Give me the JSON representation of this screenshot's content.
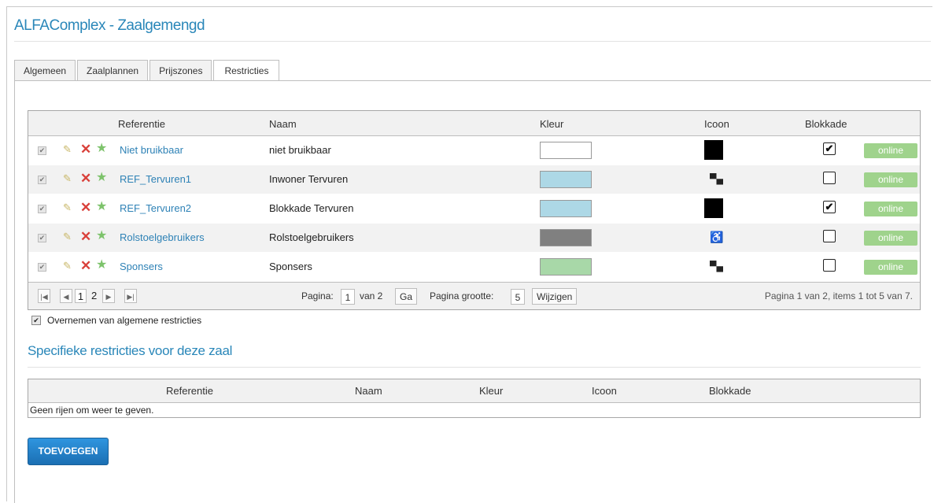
{
  "header": {
    "title": "ALFAComplex - Zaalgemengd"
  },
  "tabs": [
    {
      "label": "Algemeen",
      "active": false
    },
    {
      "label": "Zaalplannen",
      "active": false
    },
    {
      "label": "Prijszones",
      "active": false
    },
    {
      "label": "Restricties",
      "active": true
    }
  ],
  "restrictions_grid": {
    "columns": [
      "Referentie",
      "Naam",
      "Kleur",
      "Icoon",
      "Blokkade"
    ],
    "rows": [
      {
        "referentie": "Niet bruikbaar",
        "naam": "niet bruikbaar",
        "kleur": "#ffffff",
        "icoon": "black-square",
        "blokkade": true,
        "status": "online"
      },
      {
        "referentie": "REF_Tervuren1",
        "naam": "Inwoner Tervuren",
        "kleur": "#add8e6",
        "icoon": "seat-icon",
        "blokkade": false,
        "status": "online"
      },
      {
        "referentie": "REF_Tervuren2",
        "naam": "Blokkade Tervuren",
        "kleur": "#add8e6",
        "icoon": "black-square",
        "blokkade": true,
        "status": "online"
      },
      {
        "referentie": "Rolstoelgebruikers",
        "naam": "Rolstoelgebruikers",
        "kleur": "#808080",
        "icoon": "wheelchair-icon",
        "blokkade": false,
        "status": "online"
      },
      {
        "referentie": "Sponsers",
        "naam": "Sponsers",
        "kleur": "#a8d8a8",
        "icoon": "seat-icon",
        "blokkade": false,
        "status": "online"
      }
    ],
    "pager": {
      "pages": [
        "1",
        "2"
      ],
      "current_page": "1",
      "page_label": "Pagina:",
      "page_value": "1",
      "of_label": "van 2",
      "go_label": "Ga",
      "size_label": "Pagina grootte:",
      "size_value": "5",
      "change_label": "Wijzigen",
      "info": "Pagina 1 van 2, items 1 tot 5 van 7."
    }
  },
  "inherit": {
    "label": "Overnemen van algemene restricties",
    "checked": true
  },
  "specific": {
    "title": "Specifieke restricties voor deze zaal",
    "columns": [
      "Referentie",
      "Naam",
      "Kleur",
      "Icoon",
      "Blokkade"
    ],
    "empty_text": "Geen rijen om weer te geven."
  },
  "add_button": {
    "label": "TOEVOEGEN"
  }
}
